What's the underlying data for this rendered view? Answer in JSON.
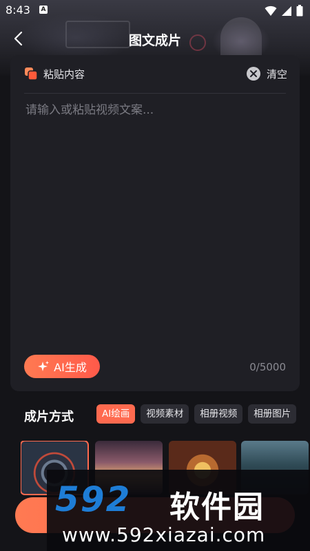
{
  "status_bar": {
    "time": "8:43",
    "app_icon": "A",
    "icons": [
      "wifi-icon",
      "signal-icon",
      "battery-icon"
    ]
  },
  "header": {
    "title": "图文成片",
    "back_icon": "chevron-left-icon"
  },
  "editor": {
    "paste_label": "粘贴内容",
    "clear_label": "清空",
    "placeholder": "请输入或粘贴视频文案...",
    "value": "",
    "ai_generate_label": "AI生成",
    "char_count": "0/5000"
  },
  "mode": {
    "title": "成片方式",
    "options": [
      {
        "label": "AI绘画",
        "active": true
      },
      {
        "label": "视频素材",
        "active": false
      },
      {
        "label": "相册视频",
        "active": false
      },
      {
        "label": "相册图片",
        "active": false
      }
    ]
  },
  "watermark": {
    "logo": "592",
    "name": "软件园",
    "url": "www.592xiazai.com"
  },
  "colors": {
    "accent": "#ff6a4f",
    "card": "#1f1f25",
    "background": "#141418",
    "watermark_blue": "#1e7dd6"
  }
}
